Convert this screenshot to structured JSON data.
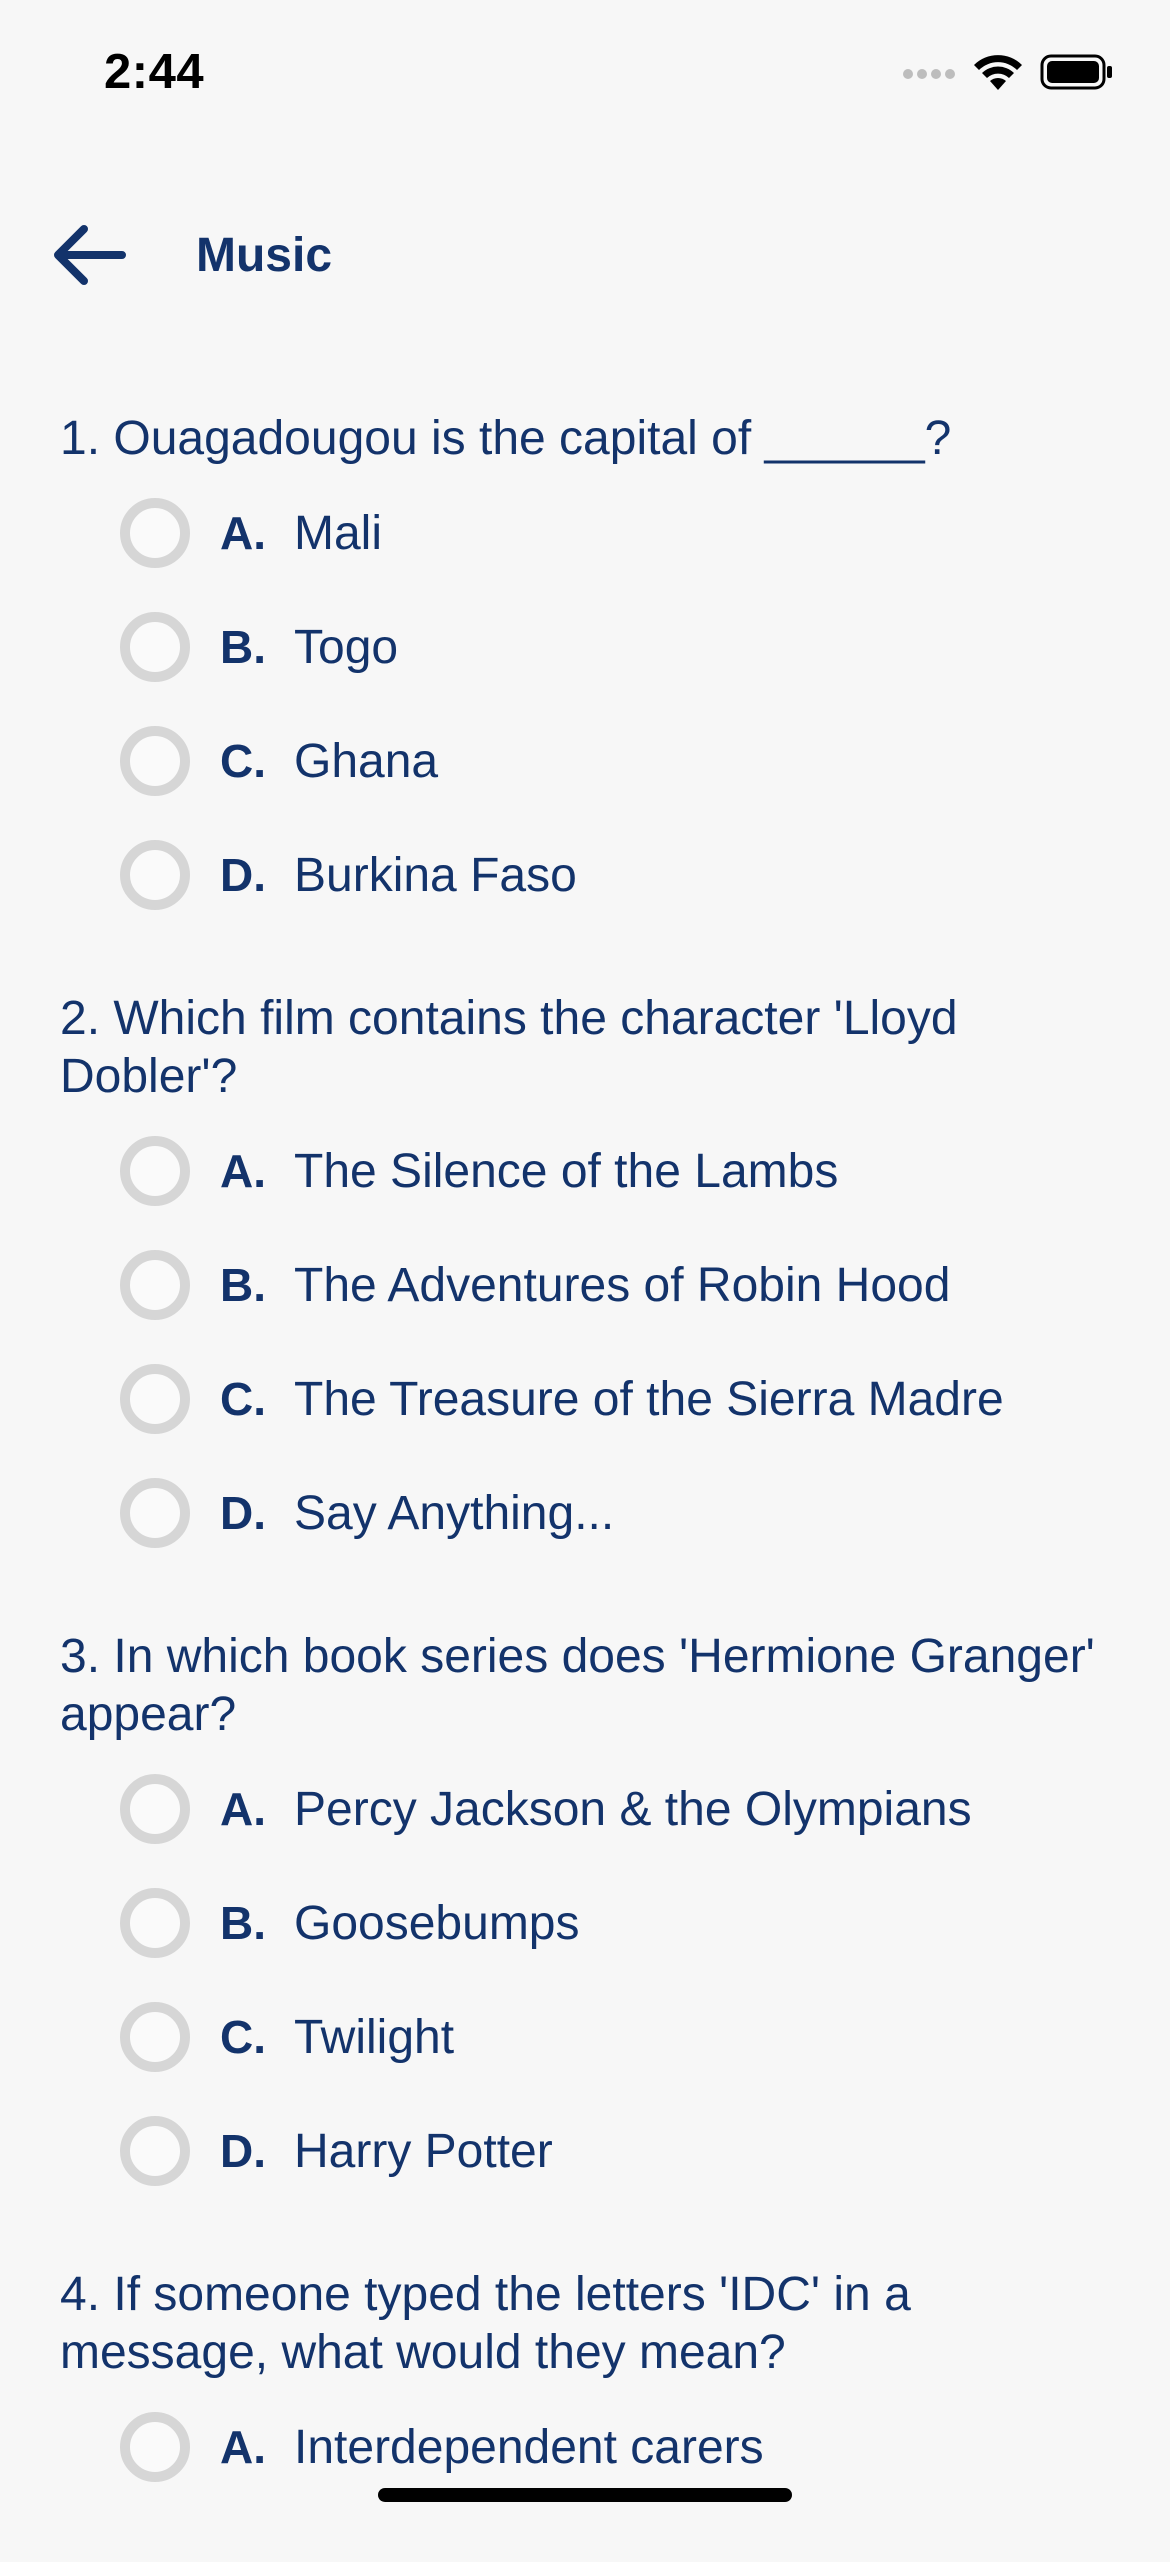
{
  "status": {
    "time": "2:44",
    "icons": [
      "cellular-icon",
      "wifi-icon",
      "battery-icon"
    ]
  },
  "header": {
    "title": "Music",
    "back_icon": "arrow-left-icon"
  },
  "colors": {
    "primary": "#13336b",
    "background": "#f7f7f7",
    "radio_border": "#d6d6d6"
  },
  "questions": [
    {
      "text": "1. Ouagadougou is the capital of ______?",
      "options": [
        {
          "letter": "A.",
          "text": "Mali"
        },
        {
          "letter": "B.",
          "text": "Togo"
        },
        {
          "letter": "C.",
          "text": "Ghana"
        },
        {
          "letter": "D.",
          "text": "Burkina Faso"
        }
      ]
    },
    {
      "text": "2. Which film contains the character 'Lloyd Dobler'?",
      "options": [
        {
          "letter": "A.",
          "text": "The Silence of the Lambs"
        },
        {
          "letter": "B.",
          "text": "The Adventures of Robin Hood"
        },
        {
          "letter": "C.",
          "text": "The Treasure of the Sierra Madre"
        },
        {
          "letter": "D.",
          "text": "Say Anything..."
        }
      ]
    },
    {
      "text": "3. In which book series does 'Hermione Granger' appear?",
      "options": [
        {
          "letter": "A.",
          "text": "Percy Jackson & the Olympians"
        },
        {
          "letter": "B.",
          "text": "Goosebumps"
        },
        {
          "letter": "C.",
          "text": "Twilight"
        },
        {
          "letter": "D.",
          "text": "Harry Potter"
        }
      ]
    },
    {
      "text": "4. If someone typed the letters 'IDC' in a message, what would they mean?",
      "options": [
        {
          "letter": "A.",
          "text": "Interdependent carers"
        }
      ]
    }
  ]
}
